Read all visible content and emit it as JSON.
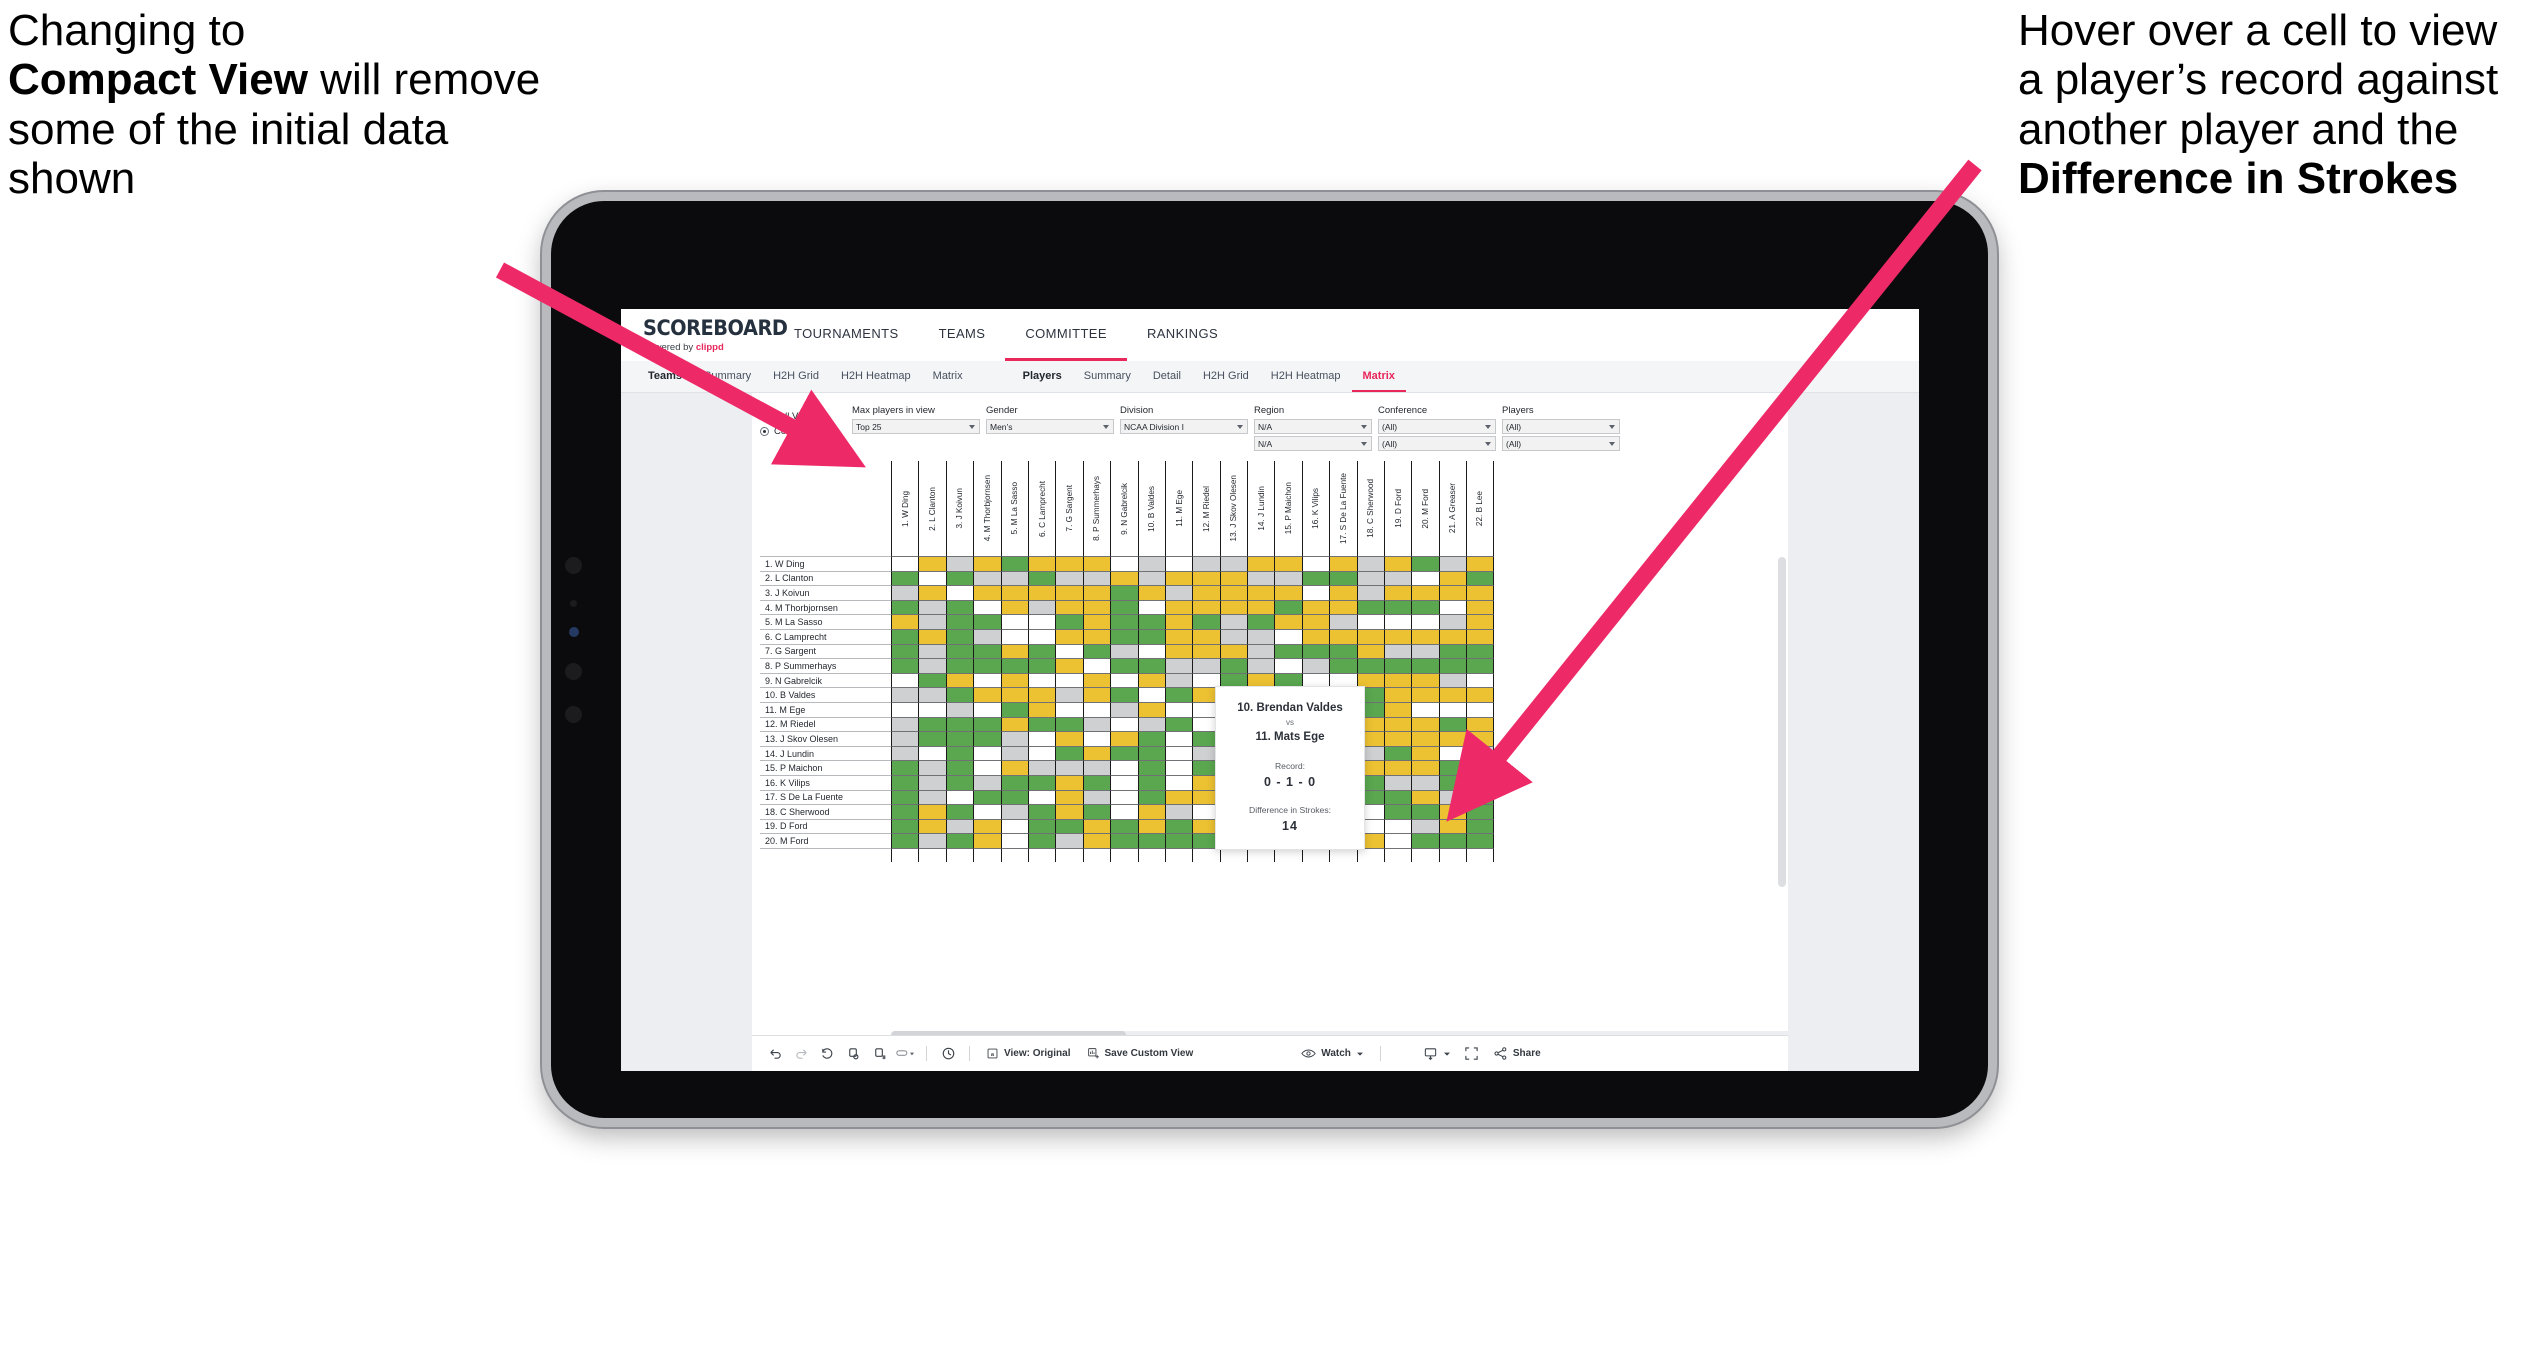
{
  "annotations": {
    "left": {
      "line1": "Changing to",
      "bold": "Compact View",
      "line2": " will remove some of the initial data shown"
    },
    "right": {
      "pre": "Hover over a cell to view a player’s record against another player and the ",
      "bold1": "Difference in",
      "bold2": "Strokes"
    }
  },
  "brand": {
    "logo": "SCOREBOARD",
    "powered_by": "Powered by ",
    "powered_by_brand": "clippd"
  },
  "topnav": [
    {
      "label": "TOURNAMENTS",
      "active": false
    },
    {
      "label": "TEAMS",
      "active": false
    },
    {
      "label": "COMMITTEE",
      "active": true
    },
    {
      "label": "RANKINGS",
      "active": false
    }
  ],
  "subnav_teams": [
    {
      "label": "Teams",
      "head": true
    },
    {
      "label": "Summary"
    },
    {
      "label": "H2H Grid"
    },
    {
      "label": "H2H Heatmap"
    },
    {
      "label": "Matrix"
    }
  ],
  "subnav_players": [
    {
      "label": "Players",
      "head": true
    },
    {
      "label": "Summary"
    },
    {
      "label": "Detail"
    },
    {
      "label": "H2H Grid"
    },
    {
      "label": "H2H Heatmap"
    },
    {
      "label": "Matrix",
      "active": true
    }
  ],
  "filters": {
    "view_options": [
      {
        "label": "Full View",
        "selected": false
      },
      {
        "label": "Compact View",
        "selected": true
      }
    ],
    "max_players": {
      "label": "Max players in view",
      "value": "Top 25"
    },
    "gender": {
      "label": "Gender",
      "value": "Men’s"
    },
    "division": {
      "label": "Division",
      "value": "NCAA Division I"
    },
    "region": {
      "label": "Region",
      "value": "N/A",
      "value2": "N/A"
    },
    "conference": {
      "label": "Conference",
      "value": "(All)",
      "value2": "(All)"
    },
    "players": {
      "label": "Players",
      "value": "(All)",
      "value2": "(All)"
    }
  },
  "matrix": {
    "columns": [
      "1. W Ding",
      "2. L Clanton",
      "3. J Koivun",
      "4. M Thorbjornsen",
      "5. M La Sasso",
      "6. C Lamprecht",
      "7. G Sargent",
      "8. P Summerhays",
      "9. N Gabrelcik",
      "10. B Valdes",
      "11. M Ege",
      "12. M Riedel",
      "13. J Skov Olesen",
      "14. J Lundin",
      "15. P Maichon",
      "16. K Vilips",
      "17. S De La Fuente",
      "18. C Sherwood",
      "19. D Ford",
      "20. M Ford",
      "21. A Greaser",
      "22. B Lee"
    ],
    "rows": [
      "1. W Ding",
      "2. L Clanton",
      "3. J Koivun",
      "4. M Thorbjornsen",
      "5. M La Sasso",
      "6. C Lamprecht",
      "7. G Sargent",
      "8. P Summerhays",
      "9. N Gabrelcik",
      "10. B Valdes",
      "11. M Ege",
      "12. M Riedel",
      "13. J Skov Olesen",
      "14. J Lundin",
      "15. P Maichon",
      "16. K Vilips",
      "17. S De La Fuente",
      "18. C Sherwood",
      "19. D Ford",
      "20. M Ford"
    ],
    "legend_colors": {
      "win": "#5aa750",
      "loss": "#ecc132",
      "tie": "#cfd0d1",
      "none": "#ffffff"
    },
    "cells": [
      [
        "w",
        "y",
        "s",
        "y",
        "g",
        "y",
        "y",
        "y",
        "w",
        "s",
        "w",
        "s",
        "s",
        "y",
        "y",
        "w",
        "y",
        "s",
        "y",
        "g",
        "s",
        "y"
      ],
      [
        "g",
        "w",
        "g",
        "s",
        "s",
        "g",
        "s",
        "s",
        "y",
        "s",
        "y",
        "y",
        "y",
        "s",
        "s",
        "g",
        "g",
        "s",
        "s",
        "w",
        "y",
        "g"
      ],
      [
        "s",
        "y",
        "w",
        "y",
        "y",
        "y",
        "y",
        "y",
        "g",
        "y",
        "s",
        "y",
        "y",
        "y",
        "y",
        "w",
        "y",
        "s",
        "y",
        "y",
        "y",
        "y"
      ],
      [
        "g",
        "s",
        "g",
        "w",
        "y",
        "s",
        "y",
        "y",
        "g",
        "w",
        "y",
        "y",
        "y",
        "y",
        "g",
        "y",
        "y",
        "g",
        "g",
        "g",
        "w",
        "y"
      ],
      [
        "y",
        "s",
        "g",
        "g",
        "w",
        "w",
        "g",
        "y",
        "g",
        "g",
        "y",
        "g",
        "s",
        "g",
        "y",
        "y",
        "s",
        "w",
        "w",
        "w",
        "s",
        "y"
      ],
      [
        "g",
        "y",
        "g",
        "s",
        "w",
        "w",
        "y",
        "y",
        "g",
        "g",
        "y",
        "y",
        "s",
        "s",
        "w",
        "y",
        "y",
        "y",
        "y",
        "y",
        "y",
        "y"
      ],
      [
        "g",
        "s",
        "g",
        "g",
        "y",
        "g",
        "w",
        "g",
        "s",
        "w",
        "y",
        "y",
        "y",
        "s",
        "g",
        "g",
        "g",
        "y",
        "s",
        "s",
        "g",
        "g"
      ],
      [
        "g",
        "s",
        "g",
        "g",
        "g",
        "g",
        "y",
        "w",
        "g",
        "g",
        "s",
        "s",
        "g",
        "s",
        "w",
        "s",
        "g",
        "g",
        "g",
        "g",
        "g",
        "g"
      ],
      [
        "w",
        "g",
        "y",
        "w",
        "y",
        "w",
        "w",
        "y",
        "w",
        "y",
        "s",
        "w",
        "g",
        "y",
        "g",
        "w",
        "w",
        "y",
        "y",
        "y",
        "s",
        "w"
      ],
      [
        "s",
        "s",
        "g",
        "y",
        "y",
        "y",
        "s",
        "y",
        "g",
        "w",
        "g",
        "y",
        "y",
        "g",
        "y",
        "w",
        "g",
        "g",
        "y",
        "y",
        "y",
        "y"
      ],
      [
        "w",
        "w",
        "s",
        "w",
        "g",
        "y",
        "w",
        "w",
        "s",
        "y",
        "w",
        "w",
        "g",
        "y",
        "s",
        "s",
        "s",
        "g",
        "y",
        "w",
        "w",
        "w"
      ],
      [
        "s",
        "g",
        "g",
        "g",
        "y",
        "g",
        "g",
        "s",
        "w",
        "s",
        "g",
        "w",
        "g",
        "y",
        "s",
        "s",
        "y",
        "y",
        "y",
        "y",
        "g",
        "y"
      ],
      [
        "s",
        "g",
        "g",
        "g",
        "s",
        "w",
        "y",
        "w",
        "y",
        "g",
        "w",
        "g",
        "w",
        "g",
        "y",
        "w",
        "w",
        "y",
        "y",
        "y",
        "y",
        "y"
      ],
      [
        "s",
        "w",
        "g",
        "w",
        "s",
        "w",
        "g",
        "y",
        "g",
        "g",
        "w",
        "s",
        "g",
        "w",
        "y",
        "s",
        "s",
        "s",
        "g",
        "y",
        "w",
        "s"
      ],
      [
        "g",
        "s",
        "g",
        "w",
        "y",
        "s",
        "s",
        "s",
        "w",
        "g",
        "w",
        "g",
        "w",
        "g",
        "w",
        "s",
        "s",
        "y",
        "y",
        "y",
        "g",
        "s"
      ],
      [
        "g",
        "s",
        "g",
        "s",
        "g",
        "g",
        "y",
        "g",
        "w",
        "g",
        "w",
        "y",
        "s",
        "w",
        "g",
        "w",
        "y",
        "g",
        "s",
        "s",
        "g",
        "g"
      ],
      [
        "g",
        "s",
        "w",
        "g",
        "g",
        "w",
        "y",
        "s",
        "w",
        "g",
        "y",
        "y",
        "y",
        "g",
        "y",
        "g",
        "w",
        "g",
        "g",
        "y",
        "s",
        "g"
      ],
      [
        "g",
        "y",
        "g",
        "w",
        "s",
        "g",
        "y",
        "g",
        "w",
        "y",
        "s",
        "w",
        "y",
        "y",
        "s",
        "g",
        "w",
        "w",
        "g",
        "g",
        "y",
        "g"
      ],
      [
        "g",
        "y",
        "s",
        "y",
        "w",
        "g",
        "g",
        "y",
        "g",
        "y",
        "g",
        "y",
        "y",
        "g",
        "w",
        "g",
        "g",
        "w",
        "w",
        "s",
        "y",
        "g"
      ],
      [
        "g",
        "s",
        "g",
        "y",
        "w",
        "g",
        "s",
        "y",
        "g",
        "g",
        "g",
        "g",
        "y",
        "w",
        "g",
        "g",
        "g",
        "y",
        "w",
        "g",
        "g",
        "g"
      ]
    ]
  },
  "tooltip": {
    "player_a": "10. Brendan Valdes",
    "vs": "vs",
    "player_b": "11. Mats Ege",
    "record_label": "Record:",
    "record_value": "0 - 1 - 0",
    "diff_label": "Difference in Strokes:",
    "diff_value": "14"
  },
  "toolbar": {
    "icons": [
      "undo-icon",
      "redo-icon",
      "revert-icon",
      "refresh-icon",
      "pause-icon",
      "highlight-icon"
    ],
    "view_label": "View: Original",
    "save_label": "Save Custom View",
    "watch_label": "Watch",
    "share_label": "Share"
  },
  "accent": {
    "pink": "#e8275a",
    "arrow": "#ed2a67"
  }
}
